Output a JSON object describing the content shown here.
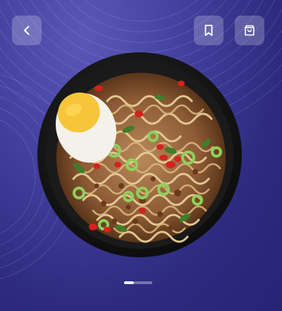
{
  "screen": {
    "name": "food-detail-hero",
    "colors": {
      "background": "#413f9c",
      "button_bg": "rgba(255,255,255,0.22)",
      "icon": "#ffffff",
      "bowl": "#141313"
    }
  },
  "toolbar": {
    "back_icon": "chevron-left-icon",
    "bookmark_icon": "bookmark-icon",
    "cart_icon": "shopping-bag-icon"
  },
  "hero": {
    "image": "bowl-of-ramen-noodles-with-egg-and-green-onion"
  },
  "pager": {
    "total": 2,
    "active": 1
  }
}
